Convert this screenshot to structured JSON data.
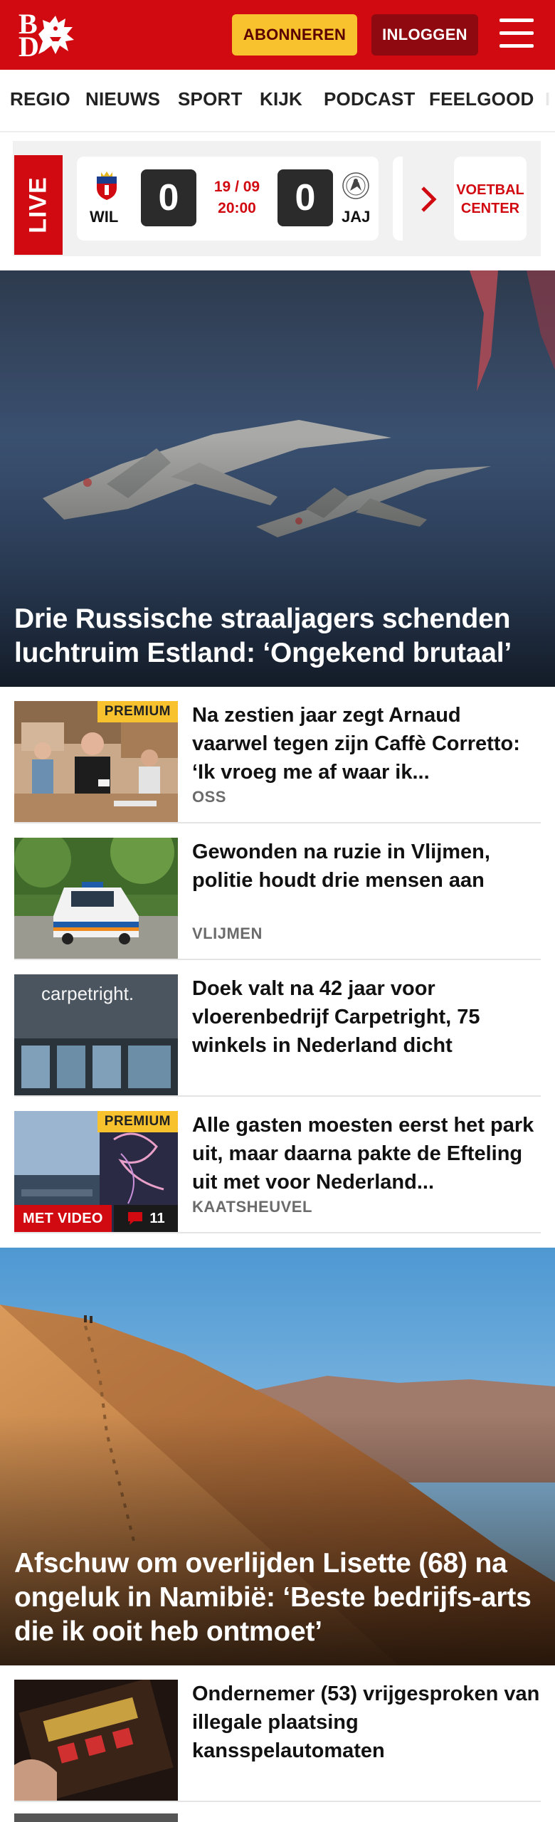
{
  "header": {
    "logo_letters": "BD",
    "subscribe_label": "ABONNEREN",
    "login_label": "INLOGGEN",
    "menu_icon": "hamburger-menu-icon",
    "brand_color": "#d10a11",
    "subscribe_color": "#f7c22e"
  },
  "nav": {
    "items": [
      "REGIO",
      "NIEUWS",
      "SPORT",
      "KIJK",
      "PODCAST",
      "FEELGOOD",
      "I"
    ]
  },
  "live": {
    "tag": "LIVE",
    "match": {
      "home_team": "WIL",
      "home_score": "0",
      "date": "19 / 09",
      "time": "20:00",
      "away_team": "JAJ",
      "away_score": "0"
    },
    "football_center_label": "VOETBAL CENTER"
  },
  "hero1": {
    "title": "Drie Russische straaljagers schenden luchtruim Estland: ‘Ongekend brutaal’"
  },
  "articles": [
    {
      "title": "Na zestien jaar zegt Arnaud vaarwel tegen zijn Caffè Corretto: ‘Ik vroeg me af waar ik...",
      "location": "OSS",
      "premium": "PREMIUM"
    },
    {
      "title": "Gewonden na ruzie in Vlijmen, politie houdt drie mensen aan",
      "location": "VLIJMEN"
    },
    {
      "title": "Doek valt na 42 jaar voor vloerenbedrijf Carpetright, 75 winkels in Nederland dicht",
      "location": "",
      "thumb_text": "carpetright."
    },
    {
      "title": "Alle gasten moesten eerst het park uit, maar daarna pakte de Efteling uit met voor Nederland...",
      "location": "KAATSHEUVEL",
      "premium": "PREMIUM",
      "video_label": "MET VIDEO",
      "comments": "11"
    }
  ],
  "hero2": {
    "title": "Afschuw om overlijden Lisette (68) na ongeluk in Namibië: ‘Beste bedrijfs-arts die ik ooit heb ontmoet’"
  },
  "article_last": {
    "title": "Ondernemer (53) vrijgesproken van illegale plaatsing kansspelautomaten"
  }
}
